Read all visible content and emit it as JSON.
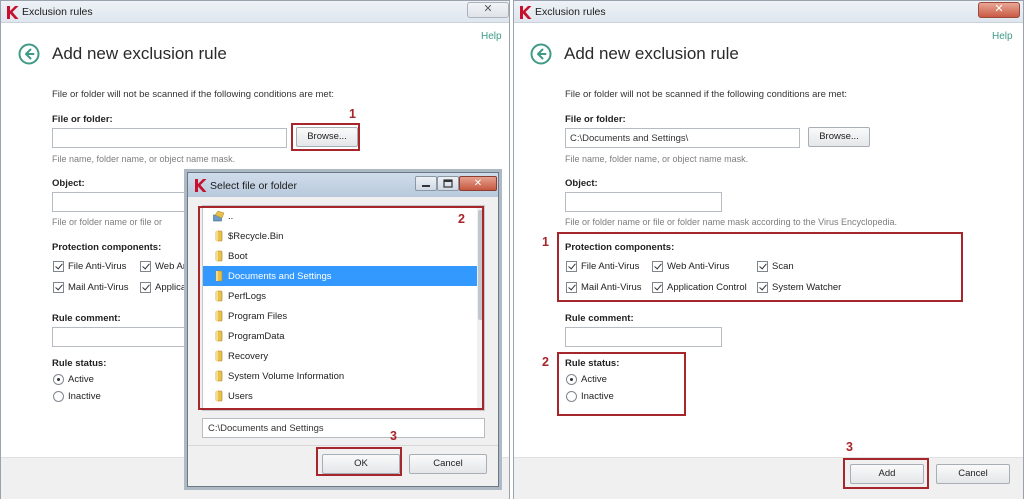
{
  "colors": {
    "accent": "#3f9a86",
    "annotation": "#a6262b",
    "selection": "#3399ff"
  },
  "left_window": {
    "title": "Exclusion rules",
    "close_label": "✕",
    "help_label": "Help",
    "heading": "Add new exclusion rule",
    "description": "File or folder will not be scanned if the following conditions are met:",
    "file_label": "File or folder:",
    "file_value": "",
    "browse_label": "Browse...",
    "file_hint": "File name, folder name, or object name mask.",
    "object_label": "Object:",
    "object_hint": "File or folder name or file or",
    "protection_label": "Protection components:",
    "checks": [
      "File Anti-Virus",
      "Web Anti",
      "Mail Anti-Virus",
      "Applicati"
    ],
    "comment_label": "Rule comment:",
    "status_label": "Rule status:",
    "status_options": [
      "Active",
      "Inactive"
    ]
  },
  "dialog": {
    "title": "Select file or folder",
    "close_label": "✕",
    "folders": [
      "..",
      "$Recycle.Bin",
      "Boot",
      "Documents and Settings",
      "PerfLogs",
      "Program Files",
      "ProgramData",
      "Recovery",
      "System Volume Information",
      "Users"
    ],
    "selected_index": 3,
    "path_value": "C:\\Documents and Settings",
    "ok_label": "OK",
    "cancel_label": "Cancel"
  },
  "right_window": {
    "title": "Exclusion rules",
    "close_label": "✕",
    "help_label": "Help",
    "heading": "Add new exclusion rule",
    "description": "File or folder will not be scanned if the following conditions are met:",
    "file_label": "File or folder:",
    "file_value": "C:\\Documents and Settings\\",
    "browse_label": "Browse...",
    "file_hint": "File name, folder name, or object name mask.",
    "object_label": "Object:",
    "object_hint": "File or folder name or file or folder name mask according to the Virus Encyclopedia.",
    "protection_label": "Protection components:",
    "checks": [
      "File Anti-Virus",
      "Web Anti-Virus",
      "Scan",
      "Mail Anti-Virus",
      "Application Control",
      "System Watcher"
    ],
    "comment_label": "Rule comment:",
    "status_label": "Rule status:",
    "status_options": [
      "Active",
      "Inactive"
    ],
    "add_label": "Add",
    "cancel_label": "Cancel"
  },
  "annotations": {
    "left": [
      "1",
      "2",
      "3"
    ],
    "right": [
      "1",
      "2",
      "3"
    ]
  }
}
